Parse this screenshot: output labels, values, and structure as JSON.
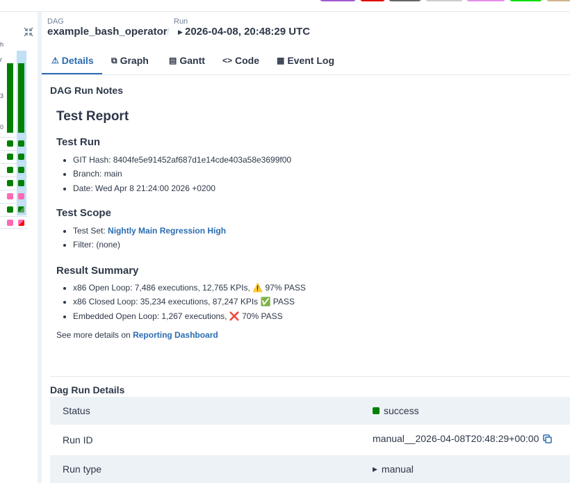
{
  "legend_colors": [
    "#a25ad1",
    "#e00000",
    "#666666",
    "#cccccc",
    "#e38ee9",
    "#00e000",
    "#d2b48c"
  ],
  "left_panel": {
    "ticks": [
      "h",
      "r",
      "3",
      "0"
    ],
    "collapse_icon": "collapse-arrows-icon"
  },
  "breadcrumb": {
    "dag_label": "DAG",
    "dag_id": "example_bash_operator",
    "run_label": "Run",
    "run_id": "2026-04-08, 20:48:29 UTC"
  },
  "tabs": [
    {
      "label": "Details",
      "icon": "warning-icon",
      "active": true
    },
    {
      "label": "Graph",
      "icon": "graph-icon"
    },
    {
      "label": "Gantt",
      "icon": "gantt-icon"
    },
    {
      "label": "Code",
      "icon": "code-icon"
    },
    {
      "label": "Event Log",
      "icon": "document-icon"
    }
  ],
  "notes": {
    "heading": "DAG Run Notes",
    "title": "Test Report",
    "sections": [
      {
        "title": "Test Run",
        "items": [
          {
            "text": "GIT Hash: 8404fe5e91452af687d1e14cde403a58e3699f00"
          },
          {
            "text": "Branch: main"
          },
          {
            "text": "Date: Wed Apr 8 21:24:00 2026 +0200"
          }
        ]
      },
      {
        "title": "Test Scope",
        "items": [
          {
            "prefix": "Test Set: ",
            "link": "Nightly Main Regression High"
          },
          {
            "text": "Filter: (none)"
          }
        ]
      },
      {
        "title": "Result Summary",
        "items": [
          {
            "text": "x86 Open Loop: 7,486 executions, 12,765 KPIs, ⚠️ 97% PASS"
          },
          {
            "text": "x86 Closed Loop: 35,234 executions, 87,247 KPIs ✅ PASS"
          },
          {
            "text": "Embedded Open Loop: 1,267 executions, ❌ 70% PASS"
          }
        ]
      }
    ],
    "more_prefix": "See more details on ",
    "more_link": "Reporting Dashboard"
  },
  "details": {
    "heading": "Dag Run Details",
    "rows": [
      {
        "key": "Status",
        "value": "success"
      },
      {
        "key": "Run ID",
        "value": "manual__2026-04-08T20:48:29+00:00"
      },
      {
        "key": "Run type",
        "value": "manual"
      }
    ]
  },
  "colors": {
    "success": "#008000",
    "queued": "#808080",
    "upstream_failed": "#ff69b4",
    "failed": "#ff0000",
    "accent": "#2b6cb0"
  }
}
